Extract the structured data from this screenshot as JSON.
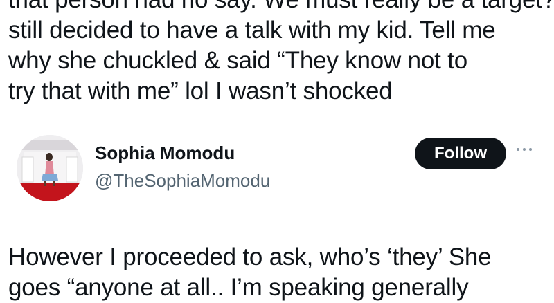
{
  "post_text_top": {
    "lines": [
      "that person had no say. We must really be a target?",
      "still decided to have a talk with my kid. Tell me",
      "why she chuckled & said “They know not to",
      "try that with me” lol I wasn’t shocked"
    ]
  },
  "quoted_author": {
    "name": "Sophia Momodu",
    "handle": "@TheSophiaMomodu",
    "follow_label": "Follow",
    "avatar_icon": "profile-photo"
  },
  "post_text_bottom": {
    "lines": [
      "However I proceeded to ask, who’s ‘they’ She",
      "goes “anyone at all.. I’m speaking generally"
    ]
  },
  "colors": {
    "text": "#0f1419",
    "secondary_text": "#536471",
    "button_bg": "#0f1419",
    "button_text": "#ffffff"
  }
}
